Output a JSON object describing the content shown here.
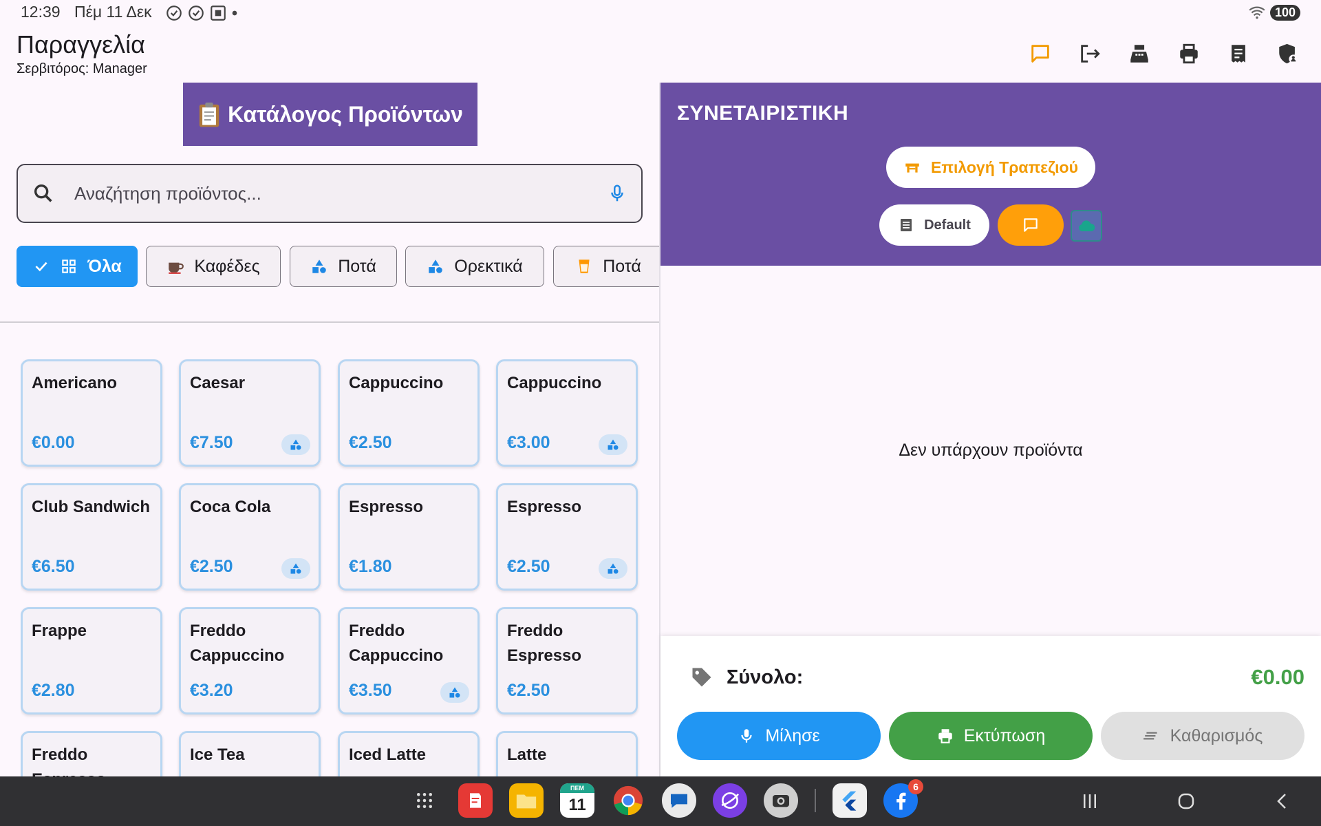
{
  "status_bar": {
    "time": "12:39",
    "date": "Πέμ 11 Δεκ",
    "battery": "100"
  },
  "header": {
    "title": "Παραγγελία",
    "subtitle": "Σερβιτόρος: Manager"
  },
  "toolbar": {
    "icons": [
      "chat-icon",
      "logout-icon",
      "cash-register-icon",
      "printer-icon",
      "receipt-icon",
      "admin-shield-icon"
    ],
    "accent": "#f29a00"
  },
  "catalog": {
    "banner_label": "Κατάλογος Προϊόντων",
    "search_placeholder": "Αναζήτηση προϊόντος...",
    "categories": [
      {
        "label": "Όλα",
        "icon": "grid-icon",
        "selected": true
      },
      {
        "label": "Καφέδες",
        "icon": "coffee-icon",
        "selected": false
      },
      {
        "label": "Ποτά",
        "icon": "shapes-icon",
        "selected": false
      },
      {
        "label": "Ορεκτικά",
        "icon": "shapes-icon",
        "selected": false
      },
      {
        "label": "Ποτά",
        "icon": "cup-icon",
        "selected": false
      }
    ],
    "products": [
      {
        "name": "Americano",
        "price": "€0.00",
        "badge": false
      },
      {
        "name": "Caesar",
        "price": "€7.50",
        "badge": true
      },
      {
        "name": "Cappuccino",
        "price": "€2.50",
        "badge": false
      },
      {
        "name": "Cappuccino",
        "price": "€3.00",
        "badge": true
      },
      {
        "name": "Club Sandwich",
        "price": "€6.50",
        "badge": false
      },
      {
        "name": "Coca Cola",
        "price": "€2.50",
        "badge": true
      },
      {
        "name": "Espresso",
        "price": "€1.80",
        "badge": false
      },
      {
        "name": "Espresso",
        "price": "€2.50",
        "badge": true
      },
      {
        "name": "Frappe",
        "price": "€2.80",
        "badge": false
      },
      {
        "name": "Freddo Cappuccino",
        "price": "€3.20",
        "badge": false
      },
      {
        "name": "Freddo Cappuccino",
        "price": "€3.50",
        "badge": true
      },
      {
        "name": "Freddo Espresso",
        "price": "€2.50",
        "badge": false
      },
      {
        "name": "Freddo Espresso",
        "price": "",
        "badge": false
      },
      {
        "name": "Ice Tea",
        "price": "",
        "badge": false
      },
      {
        "name": "Iced Latte",
        "price": "",
        "badge": false
      },
      {
        "name": "Latte",
        "price": "",
        "badge": false
      }
    ]
  },
  "order": {
    "store_name": "ΣΥΝΕΤΑΙΡΙΣΤΙΚΗ",
    "select_table_label": "Επιλογή Τραπεζιού",
    "price_list_label": "Default",
    "empty_message": "Δεν υπάρχουν προϊόντα",
    "total_label": "Σύνολο:",
    "total_value": "€0.00",
    "buttons": {
      "speak": "Μίλησε",
      "print": "Εκτύπωση",
      "clear": "Καθαρισμός"
    }
  },
  "navbar": {
    "apps": [
      "apps-grid-icon",
      "notes-app-icon",
      "files-app-icon",
      "calendar-app-icon",
      "chrome-app-icon",
      "messages-app-icon",
      "browser-app-icon",
      "camera-app-icon",
      "flutter-app-icon",
      "facebook-app-icon"
    ],
    "calendar_weekday": "ΠΕΜ",
    "calendar_day": "11",
    "facebook_badge": "6"
  }
}
